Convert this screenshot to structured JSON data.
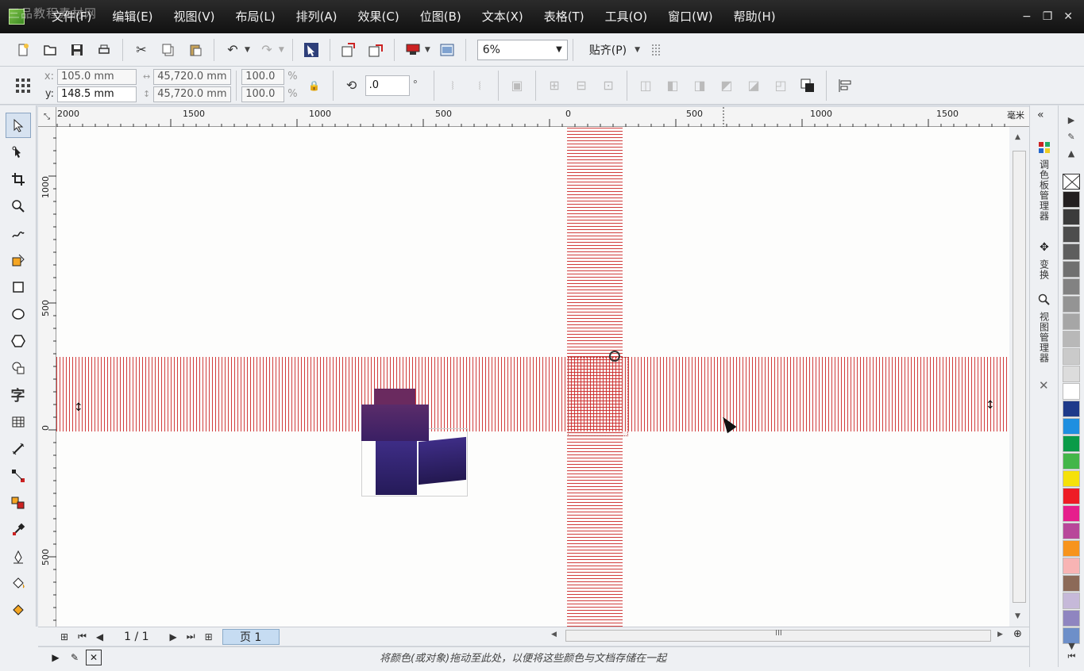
{
  "menubar": {
    "watermark": "三品教程素材网",
    "items": [
      "文件(F)",
      "编辑(E)",
      "视图(V)",
      "布局(L)",
      "排列(A)",
      "效果(C)",
      "位图(B)",
      "文本(X)",
      "表格(T)",
      "工具(O)",
      "窗口(W)",
      "帮助(H)"
    ]
  },
  "standard_toolbar": {
    "zoom_value": "6%",
    "snap_label": "贴齐(P)"
  },
  "property_bar": {
    "x_label": "x:",
    "y_label": "y:",
    "x_value": "105.0 mm",
    "y_value": "148.5 mm",
    "width_value": "45,720.0 mm",
    "height_value": "45,720.0 mm",
    "scale_x": "100.0",
    "scale_y": "100.0",
    "percent": "%",
    "rotation_value": ".0",
    "degree": "°"
  },
  "ruler_top": {
    "unit": "毫米",
    "labels": [
      "2000",
      "1500",
      "1000",
      "500",
      "0",
      "500",
      "1000",
      "1500"
    ]
  },
  "ruler_left": {
    "labels": [
      "1000",
      "500",
      "0",
      "500"
    ]
  },
  "page_nav": {
    "page_count": "1 / 1",
    "page_tab": "页 1"
  },
  "status": {
    "text": "将颜色(或对象)拖动至此处，以便将这些颜色与文档存储在一起"
  },
  "dockers": {
    "tabs": [
      "调色板管理器",
      "变换",
      "视图管理器"
    ]
  },
  "palette": {
    "colors": [
      "#231f20",
      "#3b3b3b",
      "#4d4d4d",
      "#5e5e5e",
      "#707070",
      "#828282",
      "#949494",
      "#a6a6a6",
      "#b8b8b8",
      "#cacaca",
      "#dcdcdc",
      "#ffffff",
      "#1e3a8a",
      "#1f8fe0",
      "#0a9b48",
      "#43b649",
      "#f5e10a",
      "#ee1c25",
      "#e61e8c",
      "#b8479a",
      "#f7941d",
      "#f8b4b4",
      "#8c6a58",
      "#c6b9d9",
      "#8f85c0",
      "#6d8fc9"
    ]
  },
  "icons": {
    "tools": [
      "pick-tool-icon",
      "shape-tool-icon",
      "crop-tool-icon",
      "zoom-tool-icon",
      "freehand-tool-icon",
      "smart-fill-icon",
      "rectangle-tool-icon",
      "ellipse-tool-icon",
      "polygon-tool-icon",
      "basic-shapes-icon",
      "text-tool-icon",
      "table-tool-icon",
      "dimension-tool-icon",
      "connector-tool-icon",
      "blend-tool-icon",
      "eyedropper-tool-icon",
      "outline-pen-icon",
      "fill-tool-icon",
      "interactive-fill-icon"
    ]
  }
}
